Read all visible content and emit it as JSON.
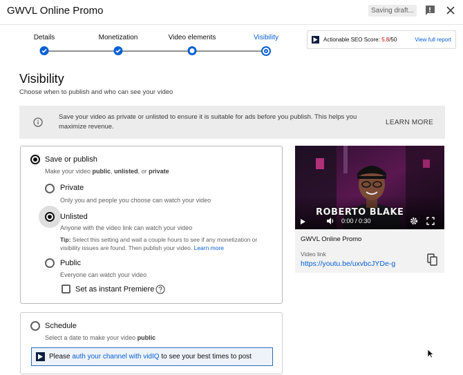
{
  "header": {
    "title": "GWVL Online Promo",
    "saving_status": "Saving draft...",
    "feedback_icon": "feedback-icon",
    "close_icon": "close-icon"
  },
  "stepper": {
    "steps": [
      {
        "label": "Details",
        "state": "done"
      },
      {
        "label": "Monetization",
        "state": "done"
      },
      {
        "label": "Video elements",
        "state": "in-progress"
      },
      {
        "label": "Visibility",
        "state": "current"
      }
    ]
  },
  "seo": {
    "label": "Actionable SEO Score:",
    "score": "5.8",
    "max": "/50",
    "link": "View full report"
  },
  "visibility": {
    "heading": "Visibility",
    "subheading": "Choose when to publish and who can see your video",
    "banner": {
      "text": "Save your video as private or unlisted to ensure it is suitable for ads before you publish. This helps you maximize revenue.",
      "learn_more": "LEARN MORE"
    },
    "save_or_publish": {
      "title": "Save or publish",
      "desc_prefix": "Make your video ",
      "desc_public": "public",
      "desc_sep1": ", ",
      "desc_unlisted": "unlisted",
      "desc_sep2": ", or ",
      "desc_private": "private",
      "options": {
        "private": {
          "label": "Private",
          "desc": "Only you and people you choose can watch your video"
        },
        "unlisted": {
          "label": "Unlisted",
          "desc": "Anyone with the video link can watch your video"
        },
        "public": {
          "label": "Public",
          "desc": "Everyone can watch your video"
        }
      },
      "selected": "Unlisted",
      "tip_label": "Tip:",
      "tip_text": " Select this setting and wait a couple hours to see if any monetization or visibility issues are found. Then publish your video. ",
      "tip_link": "Learn more",
      "premiere_label": "Set as instant Premiere"
    },
    "schedule": {
      "title": "Schedule",
      "desc_prefix": "Select a date to make your video ",
      "desc_bold": "public",
      "vidiq_prefix": "Please ",
      "vidiq_link": "auth your channel with vidIQ",
      "vidiq_suffix": " to see your best times to post"
    }
  },
  "preview": {
    "overlay_name": "ROBERTO BLAKE",
    "time": "0:00 / 0:30",
    "video_title": "GWVL Online Promo",
    "link_label": "Video link",
    "link_url": "https://youtu.be/uxvbcJYDe-g"
  },
  "colors": {
    "accent": "#065fd4",
    "score_red": "#cc0000",
    "banner_bg": "#ececec"
  }
}
